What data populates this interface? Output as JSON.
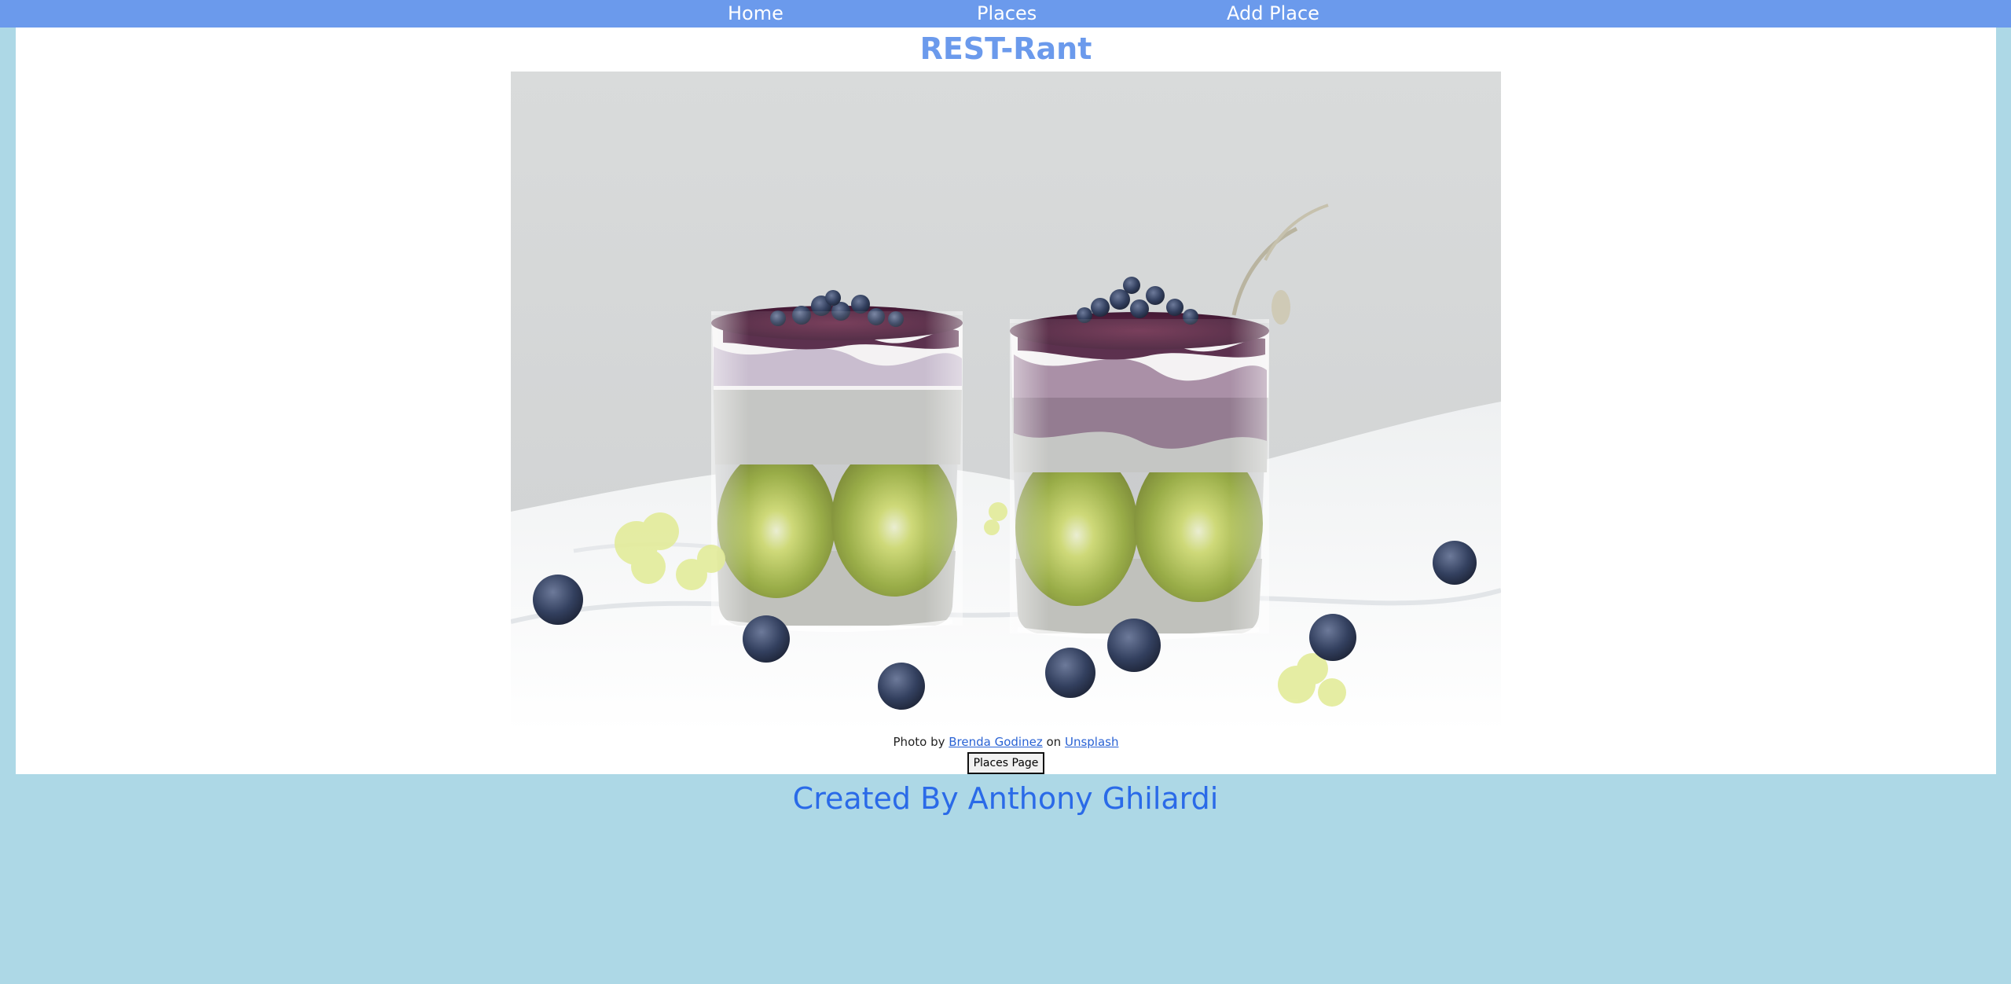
{
  "nav": {
    "home": "Home",
    "places": "Places",
    "add_place": "Add Place"
  },
  "main": {
    "title": "REST-Rant",
    "image_alt": "Chia pudding cups with kiwi and blueberries",
    "credit": {
      "prefix": "Photo by",
      "author": "Brenda Godinez",
      "middle": "on",
      "site": "Unsplash"
    },
    "places_button": "Places Page"
  },
  "footer": {
    "text": "Created By Anthony Ghilardi"
  },
  "colors": {
    "background": "#add8e6",
    "navbar": "#6b9aec",
    "title": "#6b9aec",
    "footer_text": "#2a6ae8",
    "link": "#2962d4"
  }
}
